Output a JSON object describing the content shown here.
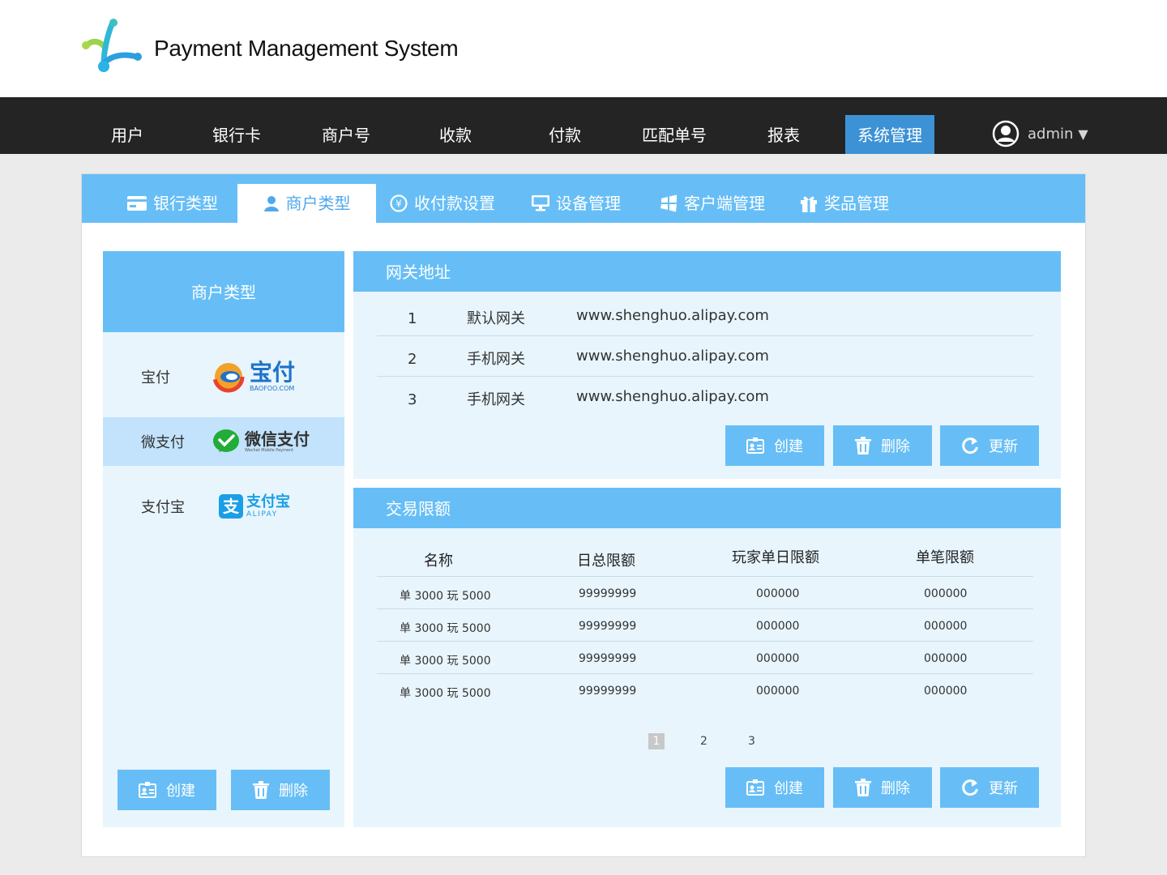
{
  "app": {
    "title": "Payment Management System"
  },
  "nav": {
    "items": [
      {
        "label": "用户"
      },
      {
        "label": "银行卡"
      },
      {
        "label": "商户号"
      },
      {
        "label": "收款"
      },
      {
        "label": "付款"
      },
      {
        "label": "匹配单号"
      },
      {
        "label": "报表"
      },
      {
        "label": "系统管理",
        "active": true
      }
    ],
    "user": {
      "name": "admin",
      "icon": "user-circle-icon",
      "dropdown_icon": "caret-down-icon"
    }
  },
  "tabs": [
    {
      "label": "银行类型",
      "icon": "card-icon"
    },
    {
      "label": "商户类型",
      "icon": "person-icon",
      "active": true
    },
    {
      "label": "收付款设置",
      "icon": "exchange-icon"
    },
    {
      "label": "设备管理",
      "icon": "monitor-icon"
    },
    {
      "label": "客户端管理",
      "icon": "windows-icon"
    },
    {
      "label": "奖品管理",
      "icon": "gift-icon"
    }
  ],
  "merchant_panel": {
    "title": "商户类型",
    "items": [
      {
        "name": "宝付",
        "logo_text": "宝付",
        "logo_sub": "BAOFOO.COM"
      },
      {
        "name": "微支付",
        "logo_text": "微信支付",
        "logo_sub": "Wechat Mobile Payment",
        "selected": true
      },
      {
        "name": "支付宝",
        "logo_text": "支付宝",
        "logo_sub": "ALIPAY"
      }
    ],
    "buttons": {
      "create": "创建",
      "delete": "删除"
    }
  },
  "gateway": {
    "title": "网关地址",
    "rows": [
      {
        "index": "1",
        "name": "默认网关",
        "url": "www.shenghuo.alipay.com"
      },
      {
        "index": "2",
        "name": "手机网关",
        "url": "www.shenghuo.alipay.com"
      },
      {
        "index": "3",
        "name": "手机网关",
        "url": "www.shenghuo.alipay.com"
      }
    ],
    "buttons": {
      "create": "创建",
      "delete": "删除",
      "refresh": "更新"
    }
  },
  "limits": {
    "title": "交易限额",
    "columns": [
      "名称",
      "日总限额",
      "玩家单日限额",
      "单笔限额"
    ],
    "rows": [
      [
        "单 3000 玩 5000",
        "99999999",
        "000000",
        "000000"
      ],
      [
        "单 3000 玩 5000",
        "99999999",
        "000000",
        "000000"
      ],
      [
        "单 3000 玩 5000",
        "99999999",
        "000000",
        "000000"
      ],
      [
        "单 3000 玩 5000",
        "99999999",
        "000000",
        "000000"
      ]
    ],
    "pages": [
      "1",
      "2",
      "3"
    ],
    "current_page": "1",
    "buttons": {
      "create": "创建",
      "delete": "删除",
      "refresh": "更新"
    }
  },
  "colors": {
    "accent": "#67bef6",
    "nav_bg": "#242424",
    "nav_active": "#3d92d5",
    "panel_bg": "#e8f5fd",
    "selected_row": "#c2e3fb"
  }
}
